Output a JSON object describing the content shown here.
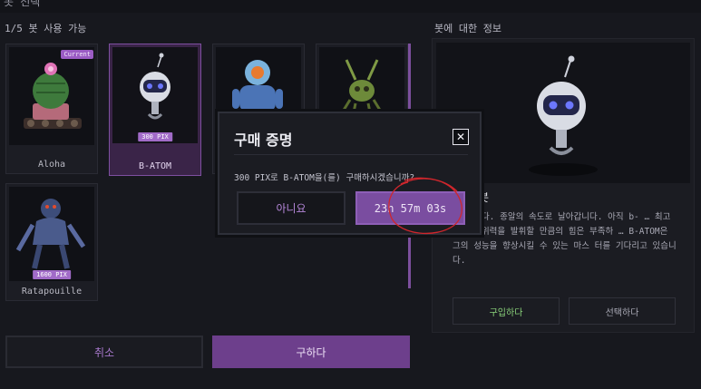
{
  "header": {
    "title": "봇 선택"
  },
  "grid": {
    "availability": "1/5 봇 사용 가능",
    "bots": [
      {
        "name": "Aloha",
        "badge": "Current"
      },
      {
        "name": "B-ATOM",
        "price": "300 PIX"
      },
      {
        "name": ""
      },
      {
        "name": ""
      },
      {
        "name": "Ratapouille",
        "price": "1600 PIX"
      }
    ]
  },
  "actions": {
    "cancel": "취소",
    "buy": "구하다"
  },
  "info": {
    "header": "봇에 대한 정보",
    "title": "봇",
    "description": "…첩합니다. 종알의 속도로 날아갑니다. 아직 b- … 최고 속도와 위력을 발휘할 만큼의 힘은 부족하 … B-ATOM은 그의 성능을 향상시킬 수 있는 마스 터를 기다리고 있습니다.",
    "buy_button": "구입하다",
    "select_button": "선택하다"
  },
  "modal": {
    "title": "구매 증명",
    "close": "✕",
    "message": "300 PIX로 B-ATOM을(를) 구매하시겠습니까?",
    "no": "아니요",
    "timer": "23h 57m 03s"
  },
  "colors": {
    "accent": "#7a4da0",
    "selected_card": "#3a2448",
    "annotation": "#d0262c"
  }
}
